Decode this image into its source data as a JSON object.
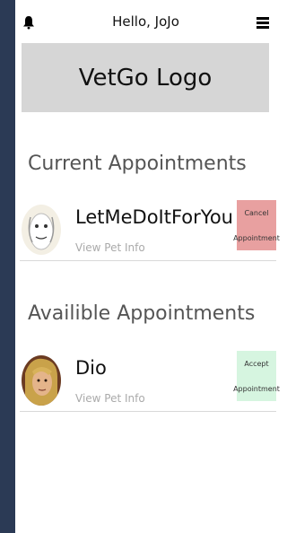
{
  "header": {
    "greeting": "Hello, JoJo",
    "bell_icon": "bell-icon",
    "menu_icon": "hamburger-menu-icon"
  },
  "logo": {
    "text": "VetGo Logo"
  },
  "current": {
    "title": "Current Appointments",
    "items": [
      {
        "pet_name": "LetMeDoItForYou",
        "link": "View Pet Info",
        "action_line1": "Cancel",
        "action_line2": "Appointment",
        "action_color": "#e8a0a0"
      }
    ]
  },
  "available": {
    "title": "Availible Appointments",
    "items": [
      {
        "pet_name": "Dio",
        "link": "View Pet Info",
        "action_line1": "Accept",
        "action_line2": "Appointment",
        "action_color": "#d6f5e0"
      }
    ]
  },
  "colors": {
    "sidebar": "#2b3a55",
    "logo_bg": "#d6d6d6"
  }
}
